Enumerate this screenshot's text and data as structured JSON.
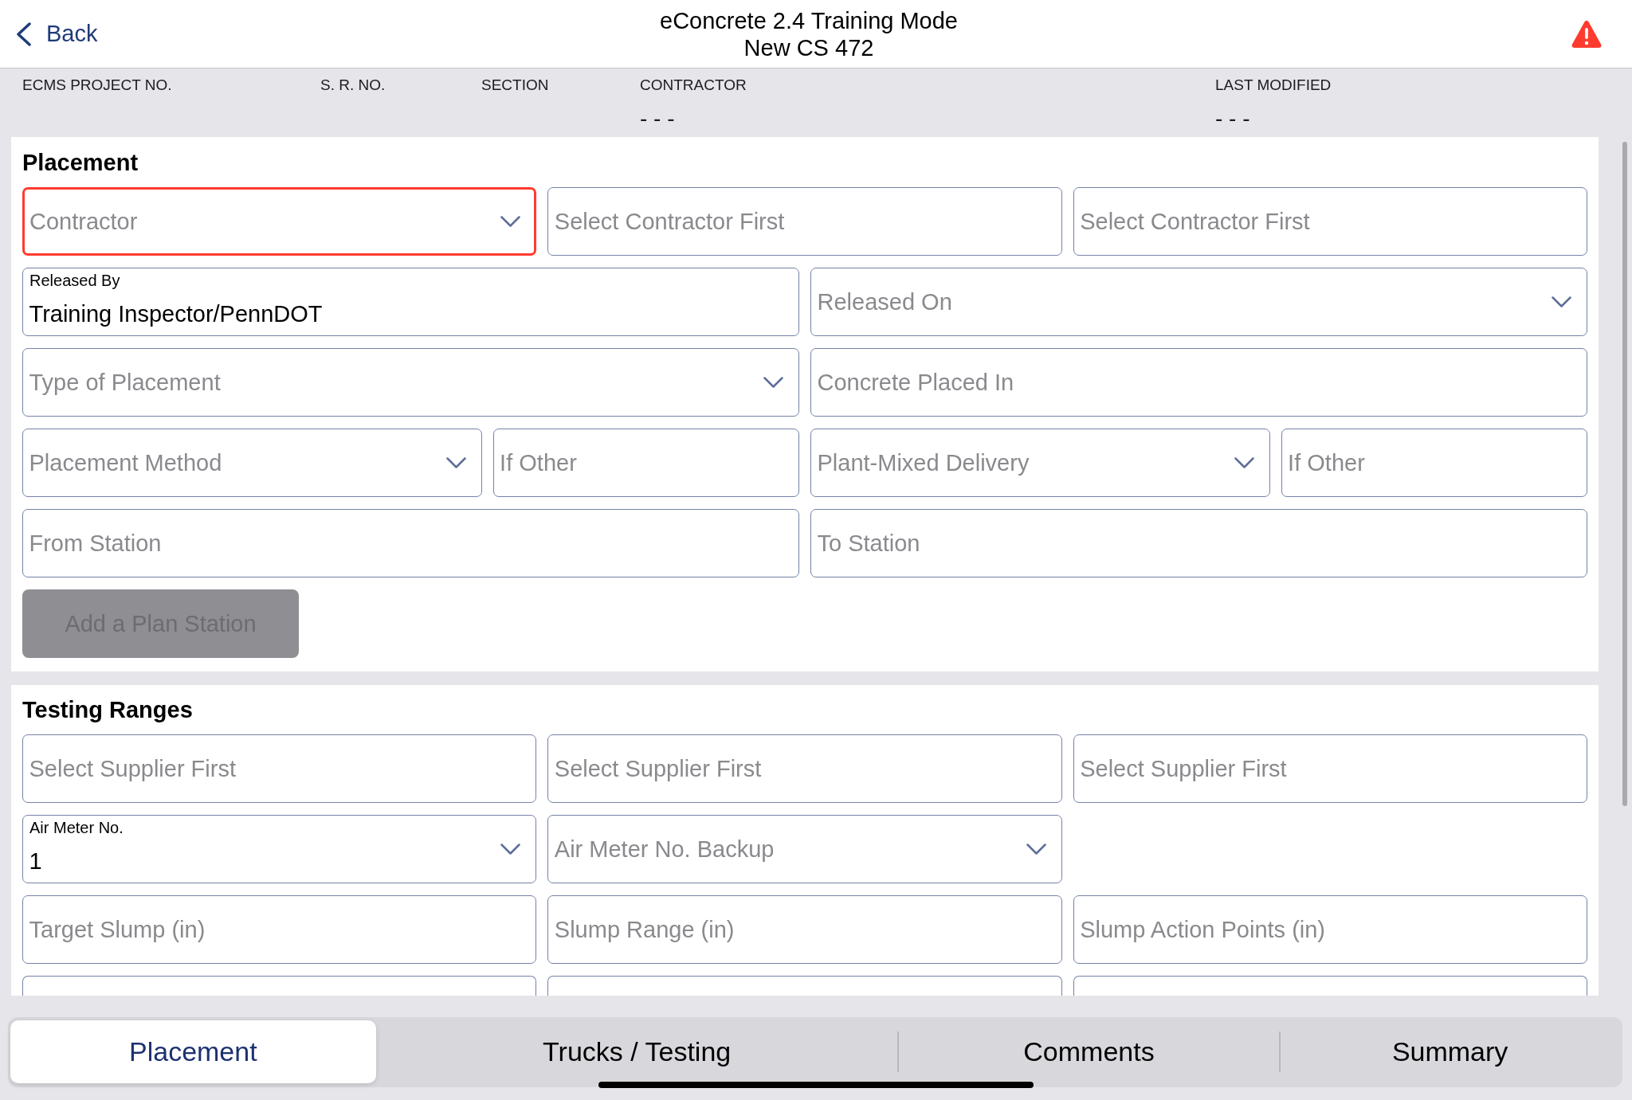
{
  "header": {
    "back_label": "Back",
    "title": "eConcrete 2.4 Training Mode",
    "subtitle": "New CS 472"
  },
  "info_bar": {
    "columns": [
      {
        "label": "ECMS PROJECT NO."
      },
      {
        "label": "S. R. NO."
      },
      {
        "label": "SECTION"
      },
      {
        "label": "CONTRACTOR",
        "value": "- - -"
      },
      {
        "label": "LAST MODIFIED",
        "value": "- - -"
      }
    ]
  },
  "sections": [
    {
      "title": "Placement",
      "rows": [
        {
          "kind": "thirds",
          "fields": [
            {
              "kind": "select",
              "placeholder": "Contractor",
              "error": true
            },
            {
              "kind": "text",
              "placeholder": "Select Contractor First",
              "error": false
            },
            {
              "kind": "text",
              "placeholder": "Select Contractor First",
              "error": false
            }
          ]
        },
        {
          "kind": "halves",
          "fields": [
            {
              "kind": "text",
              "label": "Released By",
              "value": "Training Inspector/PennDOT",
              "error": false
            },
            {
              "kind": "select",
              "placeholder": "Released On",
              "error": false
            }
          ]
        },
        {
          "kind": "halves",
          "fields": [
            {
              "kind": "select",
              "placeholder": "Type of Placement",
              "error": false
            },
            {
              "kind": "text",
              "placeholder": "Concrete Placed In",
              "error": false
            }
          ]
        },
        {
          "kind": "quarters",
          "fields": [
            {
              "kind": "select",
              "placeholder": "Placement Method",
              "error": false
            },
            {
              "kind": "text",
              "placeholder": "If Other",
              "error": false
            },
            {
              "kind": "select",
              "placeholder": "Plant-Mixed Delivery",
              "error": false
            },
            {
              "kind": "text",
              "placeholder": "If Other",
              "error": false
            }
          ]
        },
        {
          "kind": "halves",
          "fields": [
            {
              "kind": "text",
              "placeholder": "From Station",
              "error": false
            },
            {
              "kind": "text",
              "placeholder": "To Station",
              "error": false
            }
          ]
        }
      ],
      "button": {
        "label": "Add a Plan Station",
        "disabled": true
      }
    },
    {
      "title": "Testing Ranges",
      "rows": [
        {
          "kind": "thirds",
          "fields": [
            {
              "kind": "text",
              "placeholder": "Select Supplier First",
              "error": false
            },
            {
              "kind": "text",
              "placeholder": "Select Supplier First",
              "error": false
            },
            {
              "kind": "text",
              "placeholder": "Select Supplier First",
              "error": false
            }
          ]
        },
        {
          "kind": "thirds",
          "fields": [
            {
              "kind": "select",
              "label": "Air Meter No.",
              "value": "1",
              "error": false
            },
            {
              "kind": "select",
              "placeholder": "Air Meter No. Backup",
              "error": false
            }
          ]
        },
        {
          "kind": "thirds",
          "fields": [
            {
              "kind": "text",
              "placeholder": "Target Slump (in)",
              "error": false
            },
            {
              "kind": "text",
              "placeholder": "Slump Range (in)",
              "error": false
            },
            {
              "kind": "text",
              "placeholder": "Slump Action Points (in)",
              "error": false
            }
          ]
        },
        {
          "kind": "thirds",
          "fields": [
            {
              "kind": "cut",
              "error": false
            },
            {
              "kind": "cut",
              "error": false
            },
            {
              "kind": "cut",
              "error": false
            }
          ]
        }
      ]
    }
  ],
  "tabs": [
    {
      "label": "Placement",
      "selected": true
    },
    {
      "label": "Trucks / Testing",
      "selected": false
    },
    {
      "label": "Comments",
      "selected": false
    },
    {
      "label": "Summary",
      "selected": false
    }
  ]
}
